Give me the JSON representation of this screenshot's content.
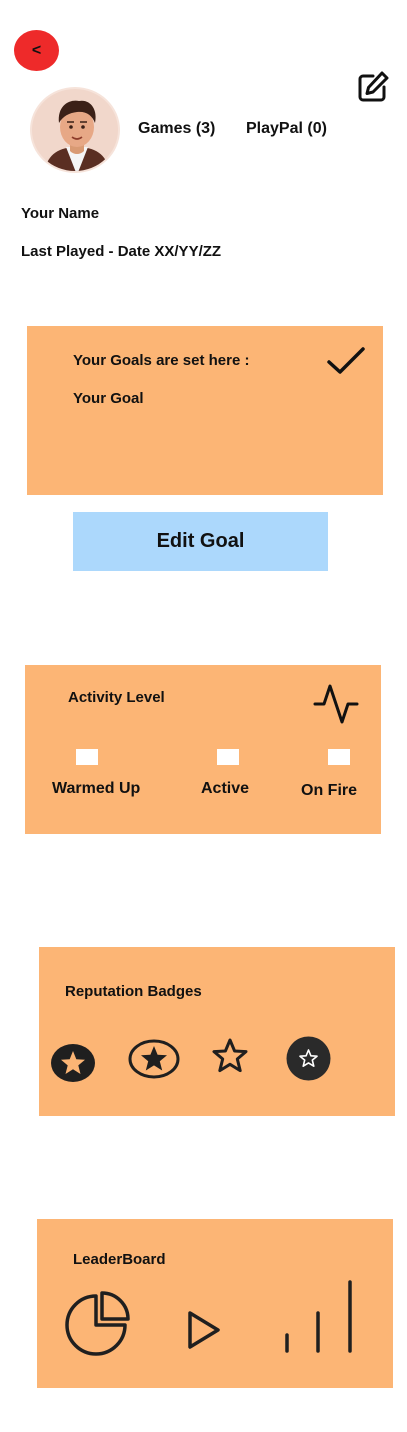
{
  "header": {
    "back_label": "<",
    "edit_icon": "edit-pencil-icon"
  },
  "profile": {
    "avatar": "user-avatar",
    "games_label": "Games (3)",
    "playpal_label": "PlayPal (0)",
    "name": "Your Name",
    "last_played": "Last Played - Date XX/YY/ZZ"
  },
  "goals": {
    "heading": "Your Goals are set here :",
    "goal_text": "Your Goal",
    "check_icon": "checkmark-icon",
    "edit_button_label": "Edit Goal"
  },
  "activity": {
    "heading": "Activity Level",
    "icon": "activity-pulse-icon",
    "levels": [
      {
        "label": "Warmed Up",
        "checked": false
      },
      {
        "label": "Active",
        "checked": false
      },
      {
        "label": "On Fire",
        "checked": false
      }
    ]
  },
  "reputation": {
    "heading": "Reputation Badges",
    "badges": [
      "star-filled-circle-icon",
      "star-outlined-circle-icon",
      "star-outline-icon",
      "star-dark-circle-icon"
    ]
  },
  "leaderboard": {
    "heading": "LeaderBoard",
    "icons": [
      "pie-chart-icon",
      "play-icon",
      "bar-chart-icon"
    ]
  },
  "colors": {
    "card": "#fcb575",
    "button_blue": "#acd8fc",
    "back_red": "#ee2a2a"
  }
}
